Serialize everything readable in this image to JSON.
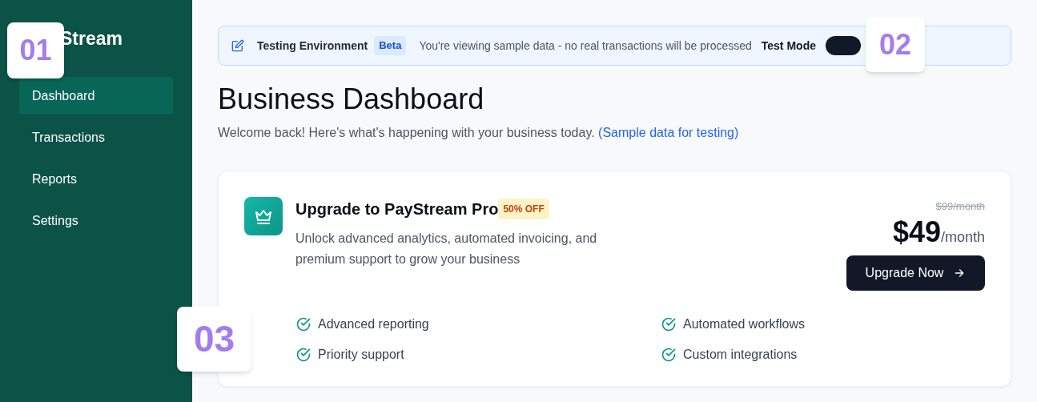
{
  "sidebar": {
    "logo": "Stream",
    "items": [
      {
        "label": "Dashboard",
        "selected": true
      },
      {
        "label": "Transactions",
        "selected": false
      },
      {
        "label": "Reports",
        "selected": false
      },
      {
        "label": "Settings",
        "selected": false
      }
    ]
  },
  "banner": {
    "title": "Testing Environment",
    "badge": "Beta",
    "message": "You're viewing sample data - no real transactions will be processed",
    "toggle_label": "Test Mode",
    "toggle_on": true
  },
  "header": {
    "title": "Business Dashboard",
    "subtitle": "Welcome back! Here's what's happening with your business today.",
    "link": "(Sample data for testing)"
  },
  "upgrade_card": {
    "title": "Upgrade to PayStream Pro",
    "discount": "50% OFF",
    "description": "Unlock advanced analytics, automated invoicing, and premium support to grow your business",
    "old_price": "$99/month",
    "price": "$49",
    "period": "/month",
    "button": "Upgrade Now",
    "features": [
      "Advanced reporting",
      "Automated workflows",
      "Priority support",
      "Custom integrations"
    ]
  },
  "markers": [
    "01",
    "02",
    "03"
  ]
}
